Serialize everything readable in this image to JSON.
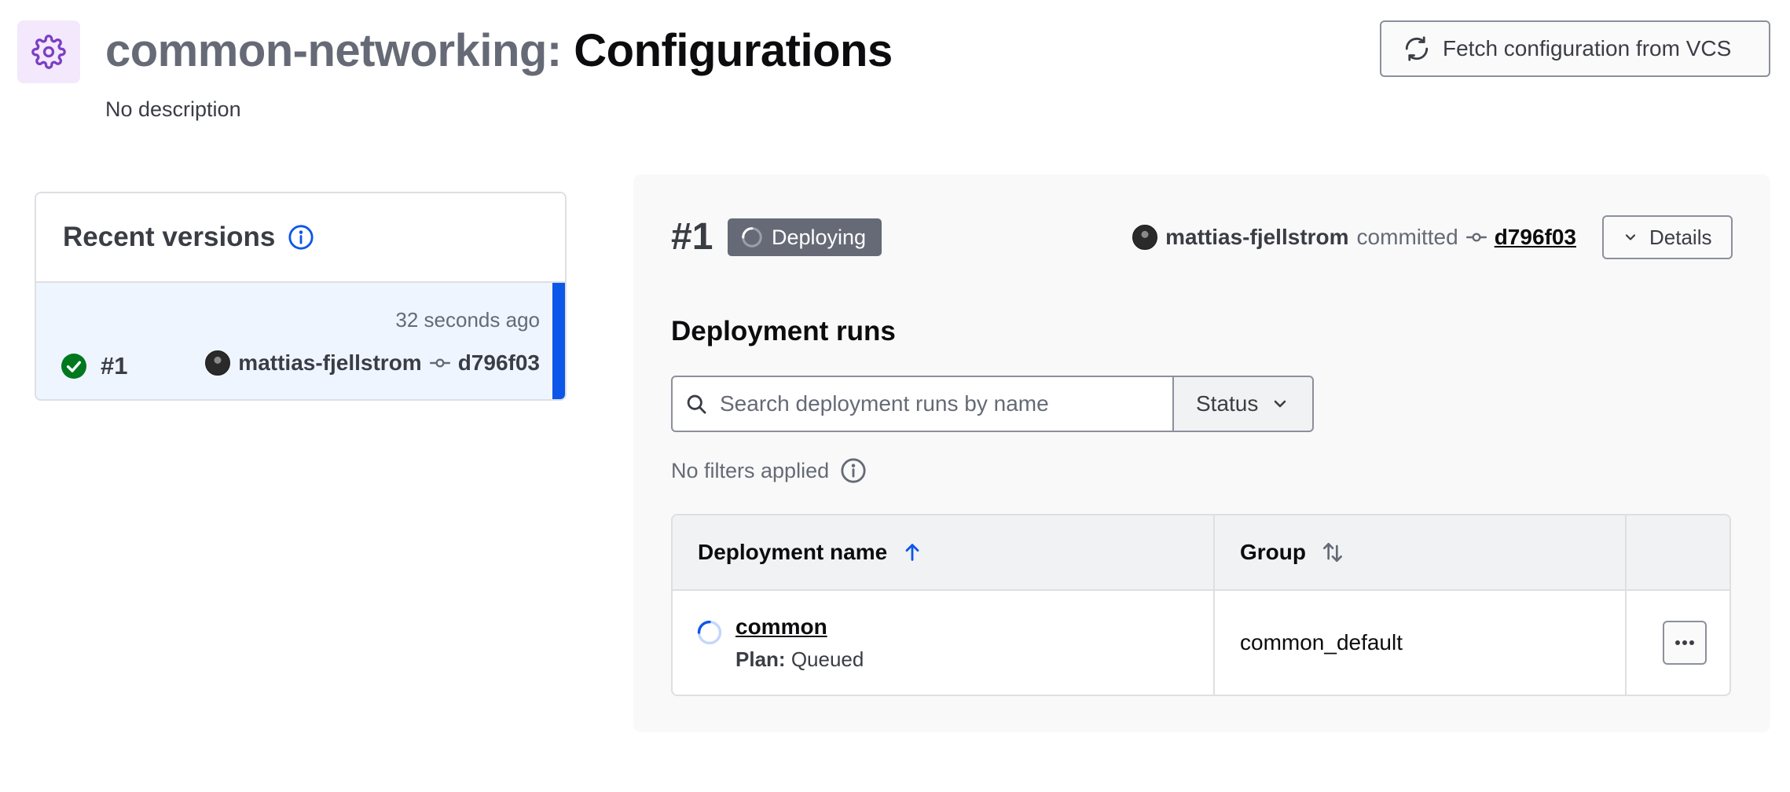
{
  "header": {
    "workspace": "common-networking:",
    "section": "Configurations",
    "description": "No description",
    "fetch_button_label": "Fetch configuration from VCS"
  },
  "recent_versions": {
    "title": "Recent versions",
    "items": [
      {
        "number": "#1",
        "time": "32 seconds ago",
        "author": "mattias-fjellstrom",
        "commit": "d796f03",
        "status": "success"
      }
    ]
  },
  "detail": {
    "version": "#1",
    "status": "Deploying",
    "author": "mattias-fjellstrom",
    "committed_label": "committed",
    "commit": "d796f03",
    "details_label": "Details"
  },
  "runs": {
    "title": "Deployment runs",
    "search_placeholder": "Search deployment runs by name",
    "status_filter": "Status",
    "no_filters": "No filters applied",
    "columns": [
      "Deployment name",
      "Group"
    ],
    "rows": [
      {
        "name": "common",
        "plan_label": "Plan:",
        "plan_status": "Queued",
        "group": "common_default"
      }
    ]
  },
  "colors": {
    "accent": "#0c56e9",
    "success": "#00781e",
    "badge": "#656a76",
    "icon_purple": "#7b3fc4"
  }
}
